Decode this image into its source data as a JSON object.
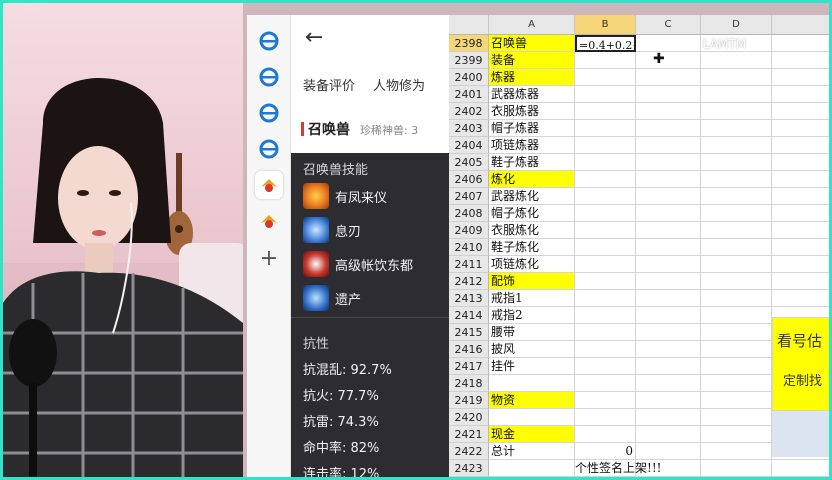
{
  "corner_text": "832x464",
  "browser_strip": {
    "icons": [
      "ie-icon",
      "ie-icon",
      "ie-icon",
      "ie-icon",
      "game-logo-icon",
      "game-logo-icon"
    ],
    "add_label": "+"
  },
  "game_panel": {
    "back_label": "←",
    "tabs": [
      "装备评价",
      "人物修为"
    ],
    "pet_title": "召唤兽",
    "pet_subtitle": "珍稀神兽: 3",
    "skills_header": "召唤兽技能",
    "skills": [
      {
        "name": "有凤来仪",
        "color": "#e7721d"
      },
      {
        "name": "息刃",
        "color": "#3f7fd6"
      },
      {
        "name": "高级帐饮东都",
        "color": "#c8382e"
      },
      {
        "name": "遗产",
        "color": "#2f6ec9"
      }
    ],
    "resist_header": "抗性",
    "stats": [
      {
        "label": "抗混乱: 92.7%"
      },
      {
        "label": "抗火: 77.7%"
      },
      {
        "label": "抗雷: 74.3%"
      },
      {
        "label": "命中率: 82%"
      },
      {
        "label": "连击率: 12%"
      }
    ]
  },
  "spreadsheet": {
    "columns": [
      "A",
      "B",
      "C",
      "D"
    ],
    "selected_column": "B",
    "rows": [
      {
        "n": "2398",
        "a": "召唤兽",
        "b": "=0.4+0.2+",
        "yellow": true,
        "editing": true
      },
      {
        "n": "2399",
        "a": "装备",
        "yellow": true
      },
      {
        "n": "2400",
        "a": "炼器",
        "yellow": true
      },
      {
        "n": "2401",
        "a": "武器炼器"
      },
      {
        "n": "2402",
        "a": "衣服炼器"
      },
      {
        "n": "2403",
        "a": "帽子炼器"
      },
      {
        "n": "2404",
        "a": "项链炼器"
      },
      {
        "n": "2405",
        "a": "鞋子炼器"
      },
      {
        "n": "2406",
        "a": "炼化",
        "yellow": true
      },
      {
        "n": "2407",
        "a": "武器炼化"
      },
      {
        "n": "2408",
        "a": "帽子炼化"
      },
      {
        "n": "2409",
        "a": "衣服炼化"
      },
      {
        "n": "2410",
        "a": "鞋子炼化"
      },
      {
        "n": "2411",
        "a": "项链炼化"
      },
      {
        "n": "2412",
        "a": "配饰",
        "yellow": true
      },
      {
        "n": "2413",
        "a": "戒指1"
      },
      {
        "n": "2414",
        "a": "戒指2"
      },
      {
        "n": "2415",
        "a": "腰带"
      },
      {
        "n": "2416",
        "a": "披风"
      },
      {
        "n": "2417",
        "a": "挂件"
      },
      {
        "n": "2418",
        "a": ""
      },
      {
        "n": "2419",
        "a": "物资",
        "yellow": true
      },
      {
        "n": "2420",
        "a": ""
      },
      {
        "n": "2421",
        "a": "现金",
        "yellow": true
      },
      {
        "n": "2422",
        "a": "总计",
        "b": "0"
      },
      {
        "n": "2423",
        "a": ""
      },
      {
        "n": "2424",
        "a": ""
      }
    ],
    "ad_line1": "看号估",
    "ad_line2": "定制找",
    "banner": "个性签名上架!!!"
  },
  "watermark": "LAMTM"
}
